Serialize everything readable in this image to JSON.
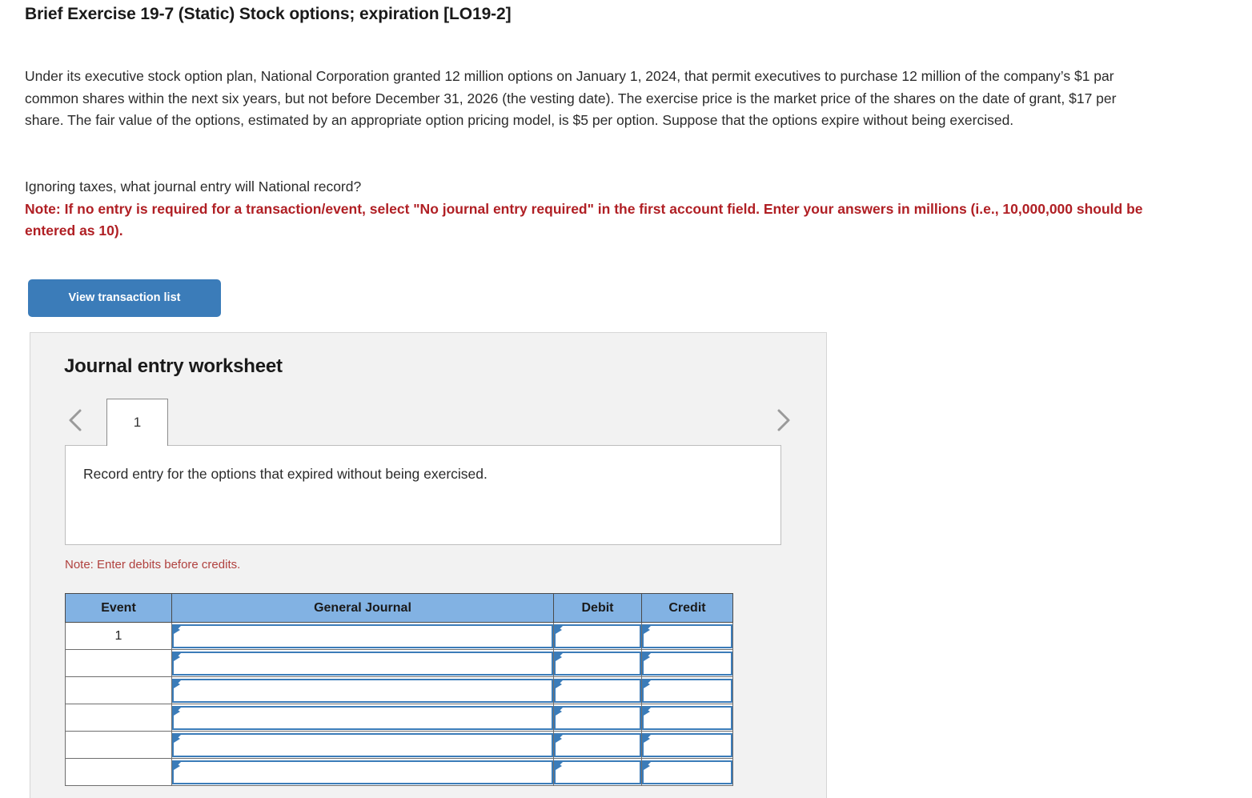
{
  "header": {
    "title": "Brief Exercise 19-7 (Static) Stock options; expiration [LO19-2]"
  },
  "problem": {
    "paragraph": "Under its executive stock option plan, National Corporation granted 12 million options on January 1, 2024, that permit executives to purchase 12 million of the company’s $1 par common shares within the next six years, but not before December 31, 2026 (the vesting date). The exercise price is the market price of the shares on the date of grant, $17 per share. The fair value of the options, estimated by an appropriate option pricing model, is $5 per option. Suppose that the options expire without being exercised.",
    "question": "Ignoring taxes, what journal entry will National record?",
    "note": "Note: If no entry is required for a transaction/event, select \"No journal entry required\" in the first account field. Enter your answers in millions (i.e., 10,000,000 should be entered as 10)."
  },
  "toolbar": {
    "view_transaction_list_label": "View transaction list",
    "button_color": "#3b7cb9"
  },
  "worksheet": {
    "title": "Journal entry worksheet",
    "prev_icon": "chevron-left-icon",
    "next_icon": "chevron-right-icon",
    "tabs": [
      {
        "label": "1",
        "active": true
      }
    ],
    "description": "Record entry for the options that expired without being exercised.",
    "debits_note": "Note: Enter debits before credits.",
    "table": {
      "headers": [
        "Event",
        "General Journal",
        "Debit",
        "Credit"
      ],
      "header_color": "#82b2e3",
      "rows": [
        {
          "event": "1",
          "general_journal": "",
          "debit": "",
          "credit": ""
        },
        {
          "event": "",
          "general_journal": "",
          "debit": "",
          "credit": ""
        },
        {
          "event": "",
          "general_journal": "",
          "debit": "",
          "credit": ""
        },
        {
          "event": "",
          "general_journal": "",
          "debit": "",
          "credit": ""
        },
        {
          "event": "",
          "general_journal": "",
          "debit": "",
          "credit": ""
        },
        {
          "event": "",
          "general_journal": "",
          "debit": "",
          "credit": ""
        }
      ]
    }
  }
}
